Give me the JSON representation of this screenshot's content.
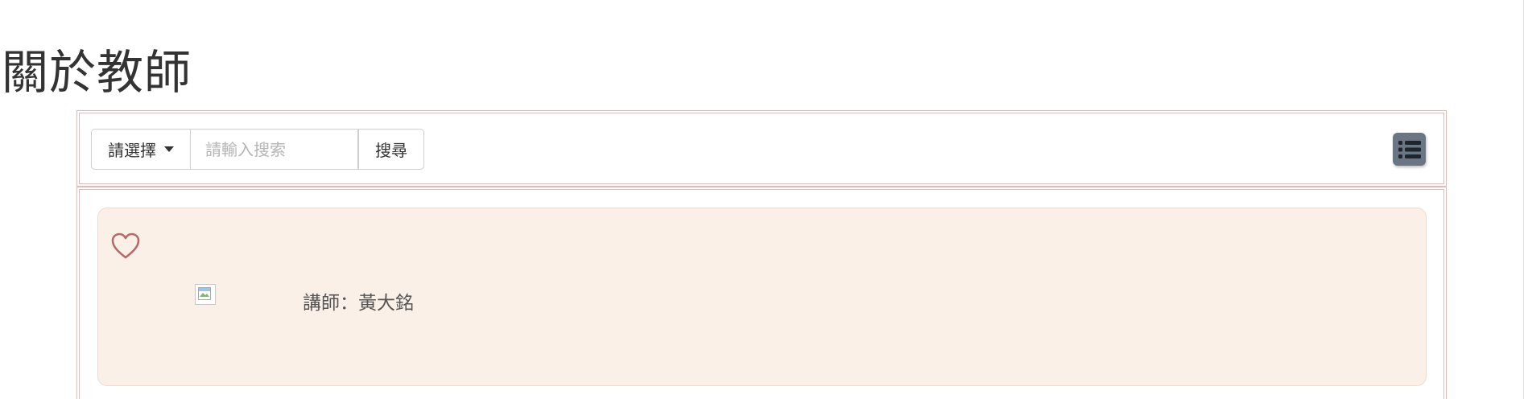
{
  "page": {
    "title": "關於教師"
  },
  "toolbar": {
    "select_label": "請選擇",
    "search_placeholder": "請輸入搜索",
    "search_button": "搜尋",
    "list_view_icon": "list-icon"
  },
  "teacher_card": {
    "favorite_icon": "heart-outline-icon",
    "photo_icon": "broken-image-icon",
    "name_text": "講師：黃大銘"
  },
  "colors": {
    "card_background": "#fbf0e8",
    "frame_border": "#e6b8b7",
    "heart_stroke": "#b56b6b",
    "list_button_bg": "#6b7685"
  }
}
